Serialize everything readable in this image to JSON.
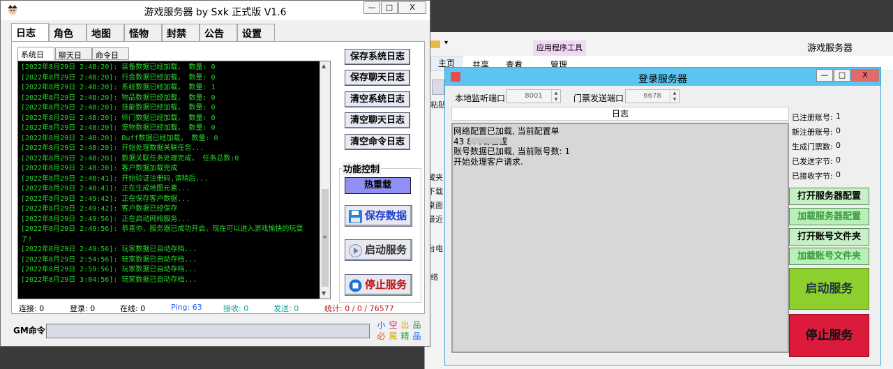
{
  "explorer": {
    "ribbon_tool": "应用程序工具",
    "window_title": "游戏服务器",
    "tabs": [
      "主页",
      "共享",
      "查看",
      "管理"
    ],
    "paste_label": "粘贴",
    "side_items": [
      "藏夹",
      "下载",
      "桌面",
      "最近",
      "台电",
      "络"
    ]
  },
  "game_window": {
    "title": "游戏服务器 by Sxk 正式版 V1.6",
    "controls": {
      "minimize": "—",
      "maximize": "□",
      "close": "X"
    },
    "tabs": [
      "日志",
      "角色",
      "地图",
      "怪物",
      "封禁",
      "公告",
      "设置"
    ],
    "subtabs": [
      "系统日志",
      "聊天日志",
      "命令日志"
    ],
    "log_lines": [
      "[2022年8月29日 2:48:20]: 装备数据已经加载， 数量: 0",
      "[2022年8月29日 2:48:20]: 行会数据已经加载， 数量: 0",
      "[2022年8月29日 2:48:20]: 系统数据已经加载， 数量: 1",
      "[2022年8月29日 2:48:20]: 物品数据已经加载， 数量: 0",
      "[2022年8月29日 2:48:20]: 技能数据已经加载， 数量: 0",
      "[2022年8月29日 2:48:20]: 师门数据已经加载， 数量: 0",
      "[2022年8月29日 2:48:20]: 宠物数据已经加载， 数量: 0",
      "[2022年8月29日 2:48:20]: Buff数据已经加载， 数量: 0",
      "[2022年8月29日 2:48:20]: 开始处理数据关联任务...",
      "[2022年8月29日 2:48:20]: 数据关联任务处理完成， 任务总数:0",
      "[2022年8月29日 2:48:20]: 客户数据加载完成",
      "[2022年8月29日 2:48:41]: 开始验证注册码,请稍后...",
      "[2022年8月29日 2:48:41]: 正在生成地图元素...",
      "[2022年8月29日 2:49:42]: 正在保存客户数据...",
      "[2022年8月29日 2:49:42]: 客户数据已经保存",
      "[2022年8月29日 2:49:56]: 正在启动网络服务...",
      "[2022年8月29日 2:49:56]: 恭喜你，服务器已成功开启，现在可以进入游戏愉快的玩耍",
      "了!",
      "[2022年8月29日 2:49:56]: 玩家数据已自动存档...",
      "[2022年8月29日 2:54:56]: 玩家数据已自动存档...",
      "[2022年8月29日 2:59:56]: 玩家数据已自动存档...",
      "[2022年8月29日 3:04:56]: 玩家数据已自动存档..."
    ],
    "buttons": {
      "save_sys_log": "保存系统日志",
      "save_chat_log": "保存聊天日志",
      "clear_sys_log": "清空系统日志",
      "clear_chat_log": "清空聊天日志",
      "clear_cmd_log": "清空命令日志",
      "func_title": "功能控制",
      "hot_reload": "热重载",
      "save_data": "保存数据",
      "start_service": "启动服务",
      "stop_service": "停止服务"
    },
    "status": {
      "connect": "连接: 0",
      "login": "登录: 0",
      "online": "在线: 0",
      "ping": "Ping: 63",
      "recv": "接收: 0",
      "send": "发送: 0",
      "stats": "统计: 0 / 0 / 76577"
    },
    "gm_label": "GM命令:",
    "gm_chars": [
      [
        "小",
        "空",
        "出",
        "品"
      ],
      [
        "必",
        "属",
        "精",
        "品"
      ]
    ],
    "colors": {
      "log_text": "#28d928",
      "ping": "#2255ff",
      "recv_send": "#10a0a0",
      "stats": "#c01010"
    }
  },
  "login_window": {
    "title": "登录服务器",
    "controls": {
      "minimize": "—",
      "maximize": "□",
      "close": "X"
    },
    "listen_port_label": "本地监听端口",
    "listen_port_value": "8001",
    "ticket_port_label": "门票发送端口",
    "ticket_port_value": "6678",
    "log_header": "日志",
    "log_lines": [
      "网络配置已加载, 当前配置单",
      "43         8701/雷霆",
      "账号数据已加载, 当前账号数: 1",
      "开始处理客户请求."
    ],
    "stats": [
      {
        "label": "已注册账号:",
        "value": "1"
      },
      {
        "label": "新注册账号:",
        "value": "0"
      },
      {
        "label": "生成门票数:",
        "value": "0"
      },
      {
        "label": "已发送字节:",
        "value": "0"
      },
      {
        "label": "已接收字节:",
        "value": "0"
      }
    ],
    "buttons": {
      "open_server_config": "打开服务器配置",
      "load_server_config": "加载服务器配置",
      "open_account_folder": "打开账号文件夹",
      "load_account_folder": "加载账号文件夹",
      "start_service": "启动服务",
      "stop_service": "停止服务"
    },
    "colors": {
      "start": "#8dd02e",
      "stop": "#dc1a3c"
    }
  }
}
